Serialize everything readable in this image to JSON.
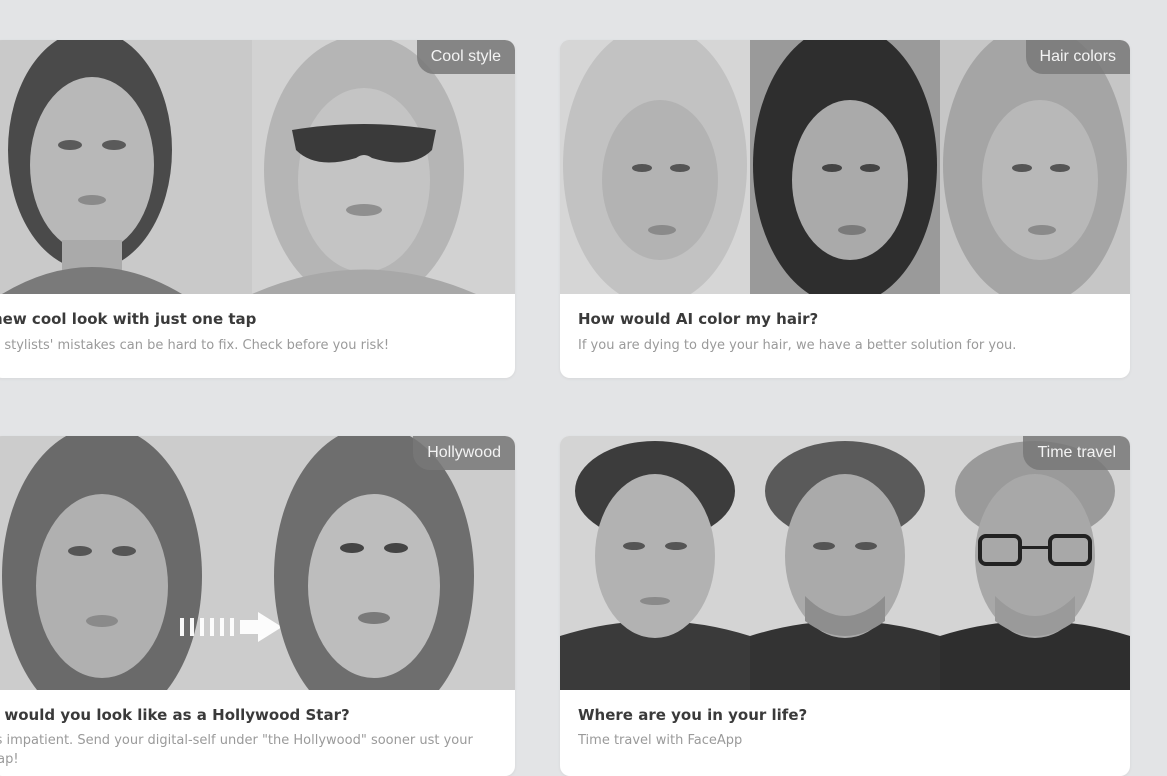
{
  "cards": [
    {
      "badge": "Cool style",
      "title": "new cool look with just one tap",
      "desc": "n stylists' mistakes can be hard to fix. Check before you risk!"
    },
    {
      "badge": "Hair colors",
      "title": "How would AI color my hair?",
      "desc": "If you are dying to dye your hair, we have a better solution for you."
    },
    {
      "badge": "Hollywood",
      "title": "t would you look like as a Hollywood Star?",
      "desc": " is impatient. Send your digital-self under \"the Hollywood\" sooner ust your tap!"
    },
    {
      "badge": "Time travel",
      "title": "Where are you in your life?",
      "desc": "Time travel with FaceApp"
    }
  ]
}
